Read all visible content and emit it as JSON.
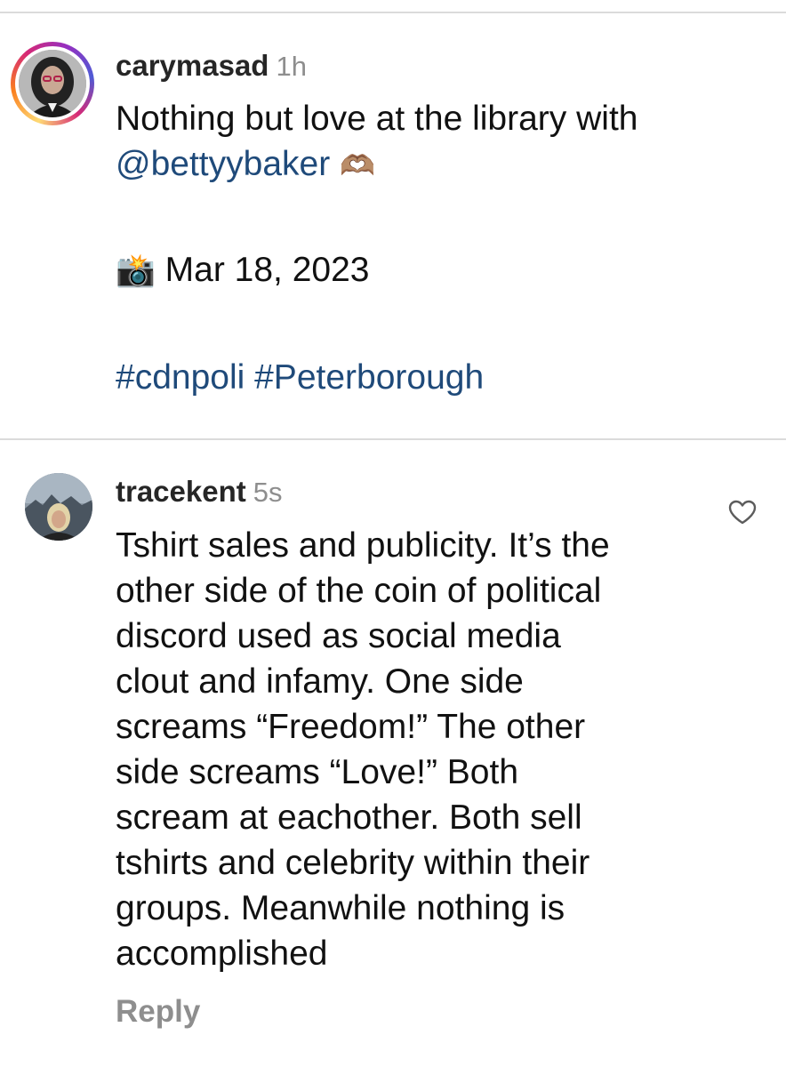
{
  "comment1": {
    "username": "carymasad",
    "time": "1h",
    "line1": "Nothing but love at the library with",
    "mention": "@bettyybaker",
    "emoji_heart_hands": "🫶🏽",
    "camera_emoji": "📸",
    "date": "Mar 18, 2023",
    "hashtags": "#cdnpoli #Peterborough"
  },
  "comment2": {
    "username": "tracekent",
    "time": "5s",
    "lines": [
      "Tshirt sales and publicity. It’s the",
      "other side of the coin of political",
      "discord used as social media",
      "clout and infamy.  One side",
      "screams “Freedom!” The other",
      "side screams “Love!” Both",
      "scream at eachother. Both sell",
      "tshirts and celebrity within their",
      "groups. Meanwhile nothing is",
      "accomplished"
    ],
    "reply_label": "Reply"
  },
  "icons": {
    "like": "heart-outline-icon"
  }
}
